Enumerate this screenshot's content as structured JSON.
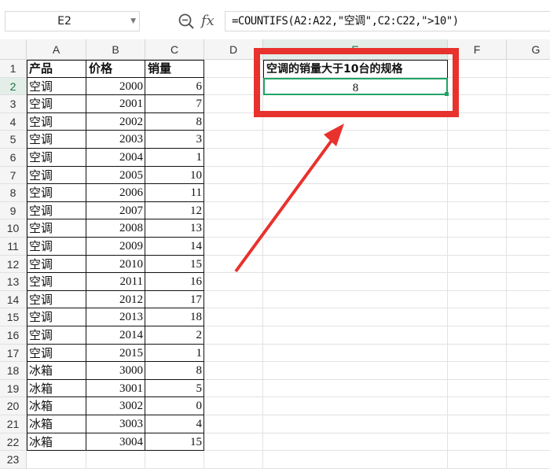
{
  "formula_bar": {
    "name_box": "E2",
    "formula": "=COUNTIFS(A2:A22,\"空调\",C2:C22,\">10\")",
    "zoom_icon": "zoom-magnifier-icon",
    "fx_label": "fx"
  },
  "columns": [
    "A",
    "B",
    "C",
    "D",
    "E",
    "F",
    "G"
  ],
  "selected_column": "E",
  "rows": [
    "1",
    "2",
    "3",
    "4",
    "5",
    "6",
    "7",
    "8",
    "9",
    "10",
    "11",
    "12",
    "13",
    "14",
    "15",
    "16",
    "17",
    "18",
    "19",
    "20",
    "21",
    "22",
    "23"
  ],
  "selected_row": "2",
  "table": {
    "headers": [
      "产品",
      "价格",
      "销量"
    ],
    "rows": [
      [
        "空调",
        "2000",
        "6"
      ],
      [
        "空调",
        "2001",
        "7"
      ],
      [
        "空调",
        "2002",
        "8"
      ],
      [
        "空调",
        "2003",
        "3"
      ],
      [
        "空调",
        "2004",
        "1"
      ],
      [
        "空调",
        "2005",
        "10"
      ],
      [
        "空调",
        "2006",
        "11"
      ],
      [
        "空调",
        "2007",
        "12"
      ],
      [
        "空调",
        "2008",
        "13"
      ],
      [
        "空调",
        "2009",
        "14"
      ],
      [
        "空调",
        "2010",
        "15"
      ],
      [
        "空调",
        "2011",
        "16"
      ],
      [
        "空调",
        "2012",
        "17"
      ],
      [
        "空调",
        "2013",
        "18"
      ],
      [
        "空调",
        "2014",
        "2"
      ],
      [
        "空调",
        "2015",
        "1"
      ],
      [
        "冰箱",
        "3000",
        "8"
      ],
      [
        "冰箱",
        "3001",
        "5"
      ],
      [
        "冰箱",
        "3002",
        "0"
      ],
      [
        "冰箱",
        "3003",
        "4"
      ],
      [
        "冰箱",
        "3004",
        "15"
      ]
    ]
  },
  "result": {
    "header": "空调的销量大于10台的规格",
    "value": "8"
  },
  "colors": {
    "annotation_red": "#e8322d",
    "selection_green": "#21a366"
  }
}
